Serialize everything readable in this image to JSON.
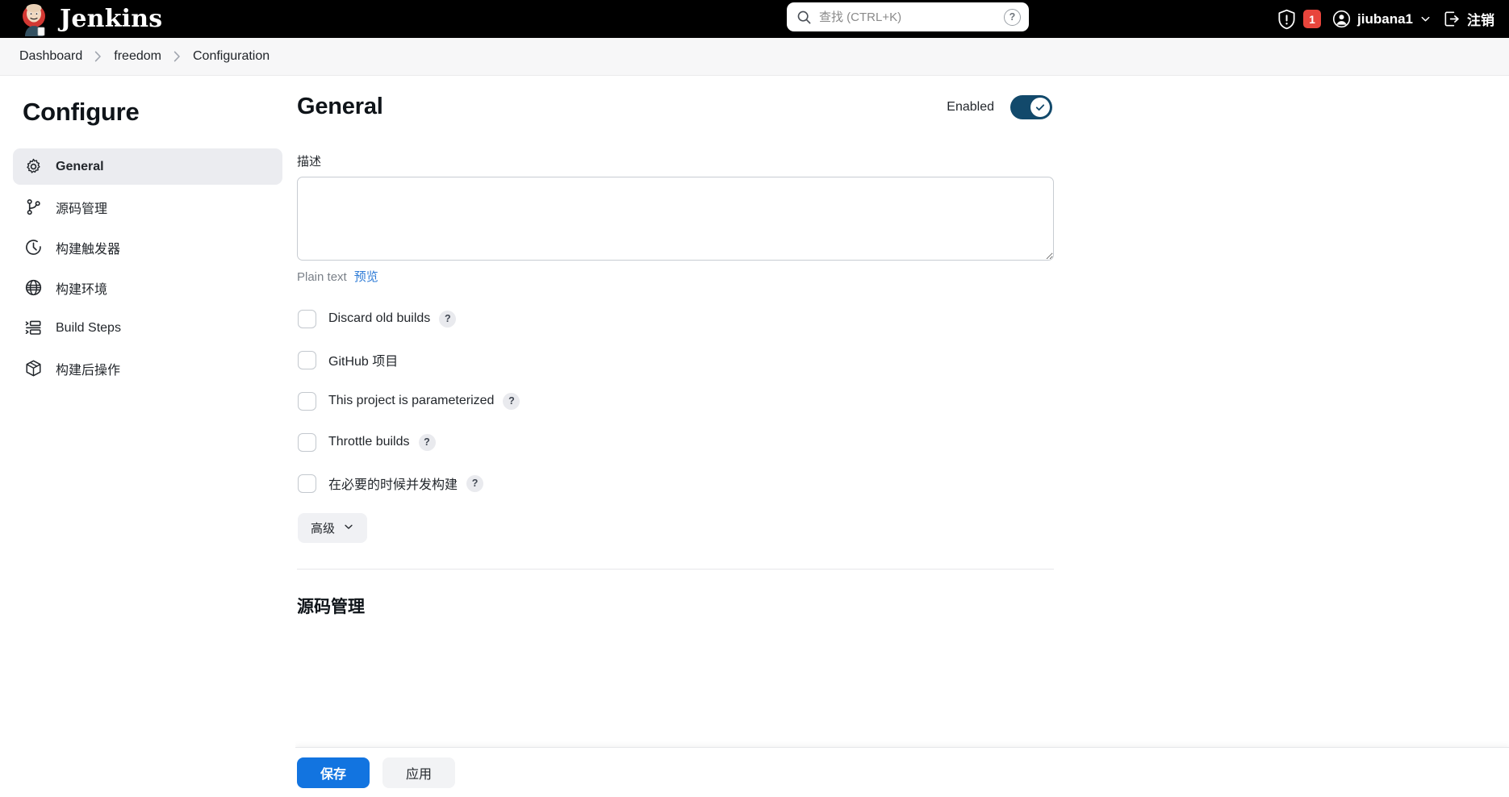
{
  "header": {
    "brand": "Jenkins",
    "brand_logo_icon": "jenkins-butler-logo",
    "search": {
      "placeholder": "查找 (CTRL+K)",
      "value": "",
      "search_icon": "search-icon",
      "help_icon": "question-mark-icon",
      "help_label": "?"
    },
    "security": {
      "shield_icon": "shield-exclamation-icon",
      "badge_count": "1"
    },
    "user": {
      "avatar_icon": "user-circle-icon",
      "name": "jiubana1",
      "chevron_icon": "chevron-down-icon"
    },
    "logout": {
      "icon": "logout-icon",
      "label": "注销"
    }
  },
  "breadcrumb": {
    "separator": "›",
    "items": [
      {
        "label": "Dashboard"
      },
      {
        "label": "freedom"
      },
      {
        "label": "Configuration"
      }
    ]
  },
  "sidebar": {
    "title": "Configure",
    "items": [
      {
        "label": "General",
        "icon": "gear-icon",
        "active": true
      },
      {
        "label": "源码管理",
        "icon": "git-branch-icon",
        "active": false
      },
      {
        "label": "构建触发器",
        "icon": "clock-icon",
        "active": false
      },
      {
        "label": "构建环境",
        "icon": "globe-icon",
        "active": false
      },
      {
        "label": "Build Steps",
        "icon": "list-steps-icon",
        "active": false
      },
      {
        "label": "构建后操作",
        "icon": "package-box-icon",
        "active": false
      }
    ]
  },
  "main": {
    "title": "General",
    "enabled": {
      "label": "Enabled",
      "state": "on",
      "check_icon": "check-icon"
    },
    "description": {
      "label": "描述",
      "value": "",
      "placeholder": "",
      "plain_text_label": "Plain text",
      "preview_link": "预览"
    },
    "checkboxes": [
      {
        "label": "Discard old builds",
        "checked": false,
        "help": "?",
        "has_help": true
      },
      {
        "label": "GitHub 项目",
        "checked": false,
        "help": "",
        "has_help": false
      },
      {
        "label": "This project is parameterized",
        "checked": false,
        "help": "?",
        "has_help": true
      },
      {
        "label": "Throttle builds",
        "checked": false,
        "help": "?",
        "has_help": true
      },
      {
        "label": "在必要的时候并发构建",
        "checked": false,
        "help": "?",
        "has_help": true
      }
    ],
    "advanced_button": {
      "label": "高级",
      "chevron_icon": "chevron-down-icon"
    },
    "next_section_title": "源码管理"
  },
  "footer": {
    "save_label": "保存",
    "apply_label": "应用"
  },
  "colors": {
    "header_bg": "#000000",
    "accent_blue": "#1274e0",
    "link_blue": "#2e7bd6",
    "toggle_on": "#12496b",
    "badge_red": "#e8453c",
    "sidebar_active_bg": "#ebecf0"
  }
}
